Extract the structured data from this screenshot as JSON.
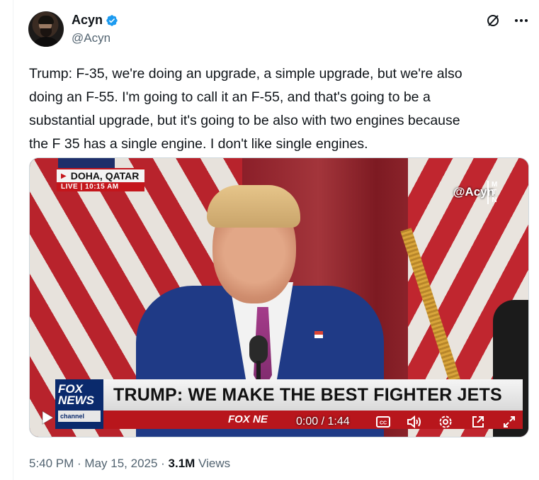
{
  "author": {
    "display_name": "Acyn",
    "handle": "@Acyn",
    "verified": true,
    "avatar_icon": "avatar-photo"
  },
  "header_actions": {
    "grok_icon": "slash-circle-icon",
    "more_icon": "more-dots-icon"
  },
  "tweet": {
    "text": "Trump: F-35, we're doing an upgrade, a simple upgrade, but we're also\ndoing an F-55. I'm going to call it an F-55, and that's going to be a\nsubstantial upgrade, but it's going to be also with two engines because\nthe F 35 has a single engine. I don't like single engines."
  },
  "video": {
    "location": "DOHA, QATAR",
    "live_label": "LIVE",
    "live_time": "10:15 AM",
    "watermark": "@Acyn",
    "watermark_mtn": "M\nT\nN",
    "network_logo_top": "FOX",
    "network_logo_mid": "NEWS",
    "network_logo_bottom": "channel",
    "headline": "TRUMP: WE MAKE THE BEST FIGHTER JETS",
    "ticker_brand": "FOX NE",
    "time_display": "0:00 / 1:44",
    "controls": [
      "play-icon",
      "captions-icon",
      "volume-icon",
      "settings-icon",
      "popout-icon",
      "fullscreen-icon"
    ]
  },
  "meta": {
    "time": "5:40 PM",
    "separator": " · ",
    "date": "May 15, 2025",
    "views_count": "3.1M",
    "views_label": " Views"
  },
  "colors": {
    "verified_blue": "#1d9bf0",
    "text_primary": "#0f1419",
    "text_secondary": "#536471",
    "fox_red": "#c4161c",
    "fox_blue": "#0a2a6c"
  }
}
